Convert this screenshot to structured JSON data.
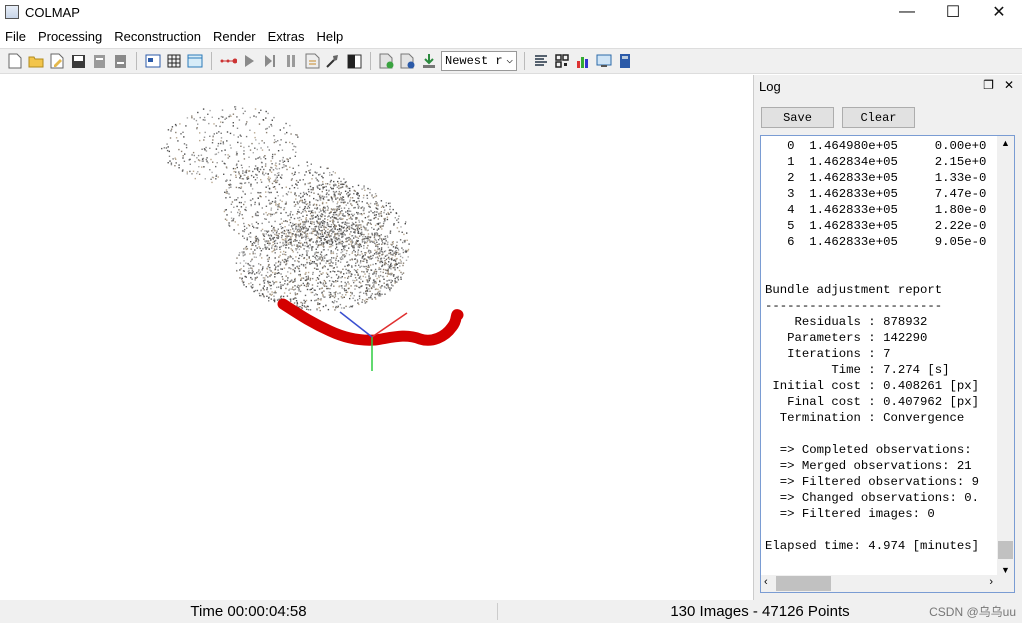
{
  "window": {
    "title": "COLMAP",
    "minimize_glyph": "—",
    "maximize_glyph": "☐",
    "close_glyph": "✕"
  },
  "menu": [
    "File",
    "Processing",
    "Reconstruction",
    "Render",
    "Extras",
    "Help"
  ],
  "toolbar": {
    "select_value": "Newest r",
    "icons": [
      "new-project-icon",
      "open-project-icon",
      "edit-project-icon",
      "save-icon",
      "import-icon",
      "export-icon",
      "images-icon",
      "grid-icon",
      "table-icon",
      "start-reconstruction-icon",
      "play-icon",
      "step-icon",
      "pause-icon",
      "bundle-adjust-icon",
      "build-icon",
      "render-options-icon",
      "model-add-icon",
      "model-icon",
      "model-export-icon",
      "reconstruction-stats-icon",
      "match-matrix-icon",
      "chart-icon",
      "screenshot-icon",
      "database-icon"
    ]
  },
  "log": {
    "title": "Log",
    "save_label": "Save",
    "clear_label": "Clear",
    "lines": [
      "   0  1.464980e+05     0.00e+0",
      "   1  1.462834e+05     2.15e+0",
      "   2  1.462833e+05     1.33e-0",
      "   3  1.462833e+05     7.47e-0",
      "   4  1.462833e+05     1.80e-0",
      "   5  1.462833e+05     2.22e-0",
      "   6  1.462833e+05     9.05e-0",
      "",
      "",
      "Bundle adjustment report",
      "------------------------",
      "    Residuals : 878932",
      "   Parameters : 142290",
      "   Iterations : 7",
      "         Time : 7.274 [s]",
      " Initial cost : 0.408261 [px]",
      "   Final cost : 0.407962 [px]",
      "  Termination : Convergence",
      "",
      "  => Completed observations: ",
      "  => Merged observations: 21",
      "  => Filtered observations: 9",
      "  => Changed observations: 0.",
      "  => Filtered images: 0",
      "",
      "Elapsed time: 4.974 [minutes]"
    ]
  },
  "status": {
    "time": "Time 00:00:04:58",
    "summary": "130 Images - 47126 Points"
  },
  "watermark": "CSDN @乌乌uu",
  "colors": {
    "camera_path": "#d40000",
    "axis_x": "#e03030",
    "axis_y": "#2ecc40",
    "axis_z": "#3a4fd0",
    "points": "#6e6e6e"
  }
}
